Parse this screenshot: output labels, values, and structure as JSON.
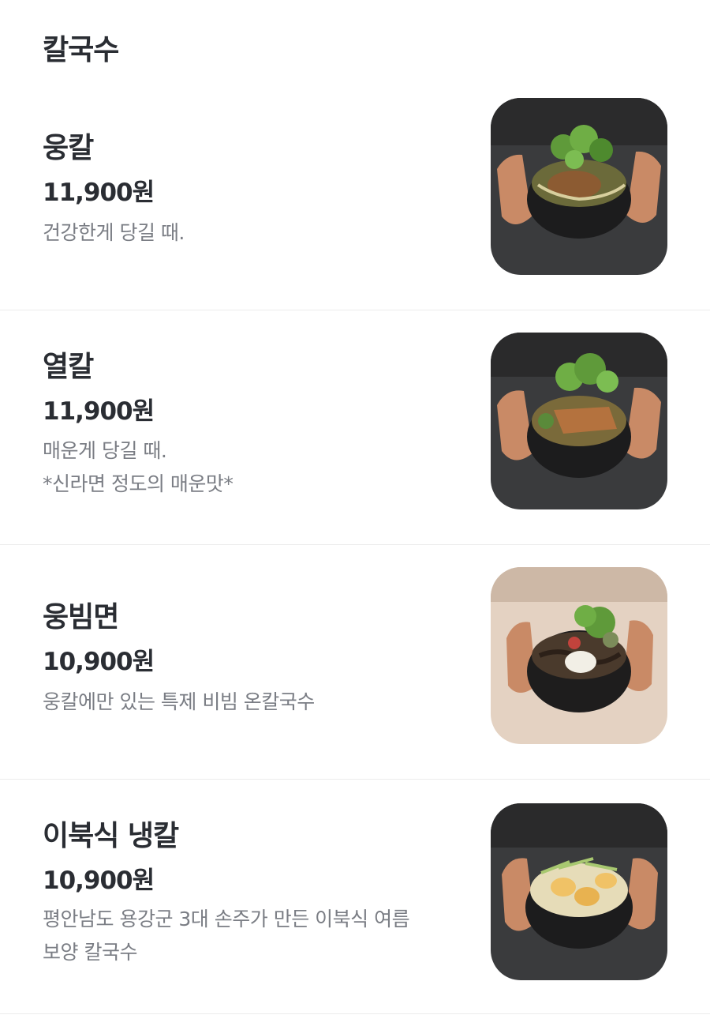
{
  "section": {
    "title": "칼국수"
  },
  "items": [
    {
      "name": "웅칼",
      "price": "11,900원",
      "desc": [
        "건강한게 당길 때."
      ],
      "image": "bowl-herb-broth-photo"
    },
    {
      "name": "열칼",
      "price": "11,900원",
      "desc": [
        "매운게 당길 때.",
        "*신라면 정도의 매운맛*"
      ],
      "image": "bowl-spicy-meat-photo"
    },
    {
      "name": "웅빔면",
      "price": "10,900원",
      "desc": [
        "웅칼에만 있는 특제 비빔 온칼국수"
      ],
      "image": "bowl-bibim-noodle-photo"
    },
    {
      "name": "이북식 냉칼",
      "price": "10,900원",
      "desc": [
        "평안남도 용강군 3대 손주가 만든 이북식 여름",
        "보양 칼국수"
      ],
      "image": "bowl-cold-egg-noodle-photo"
    }
  ]
}
